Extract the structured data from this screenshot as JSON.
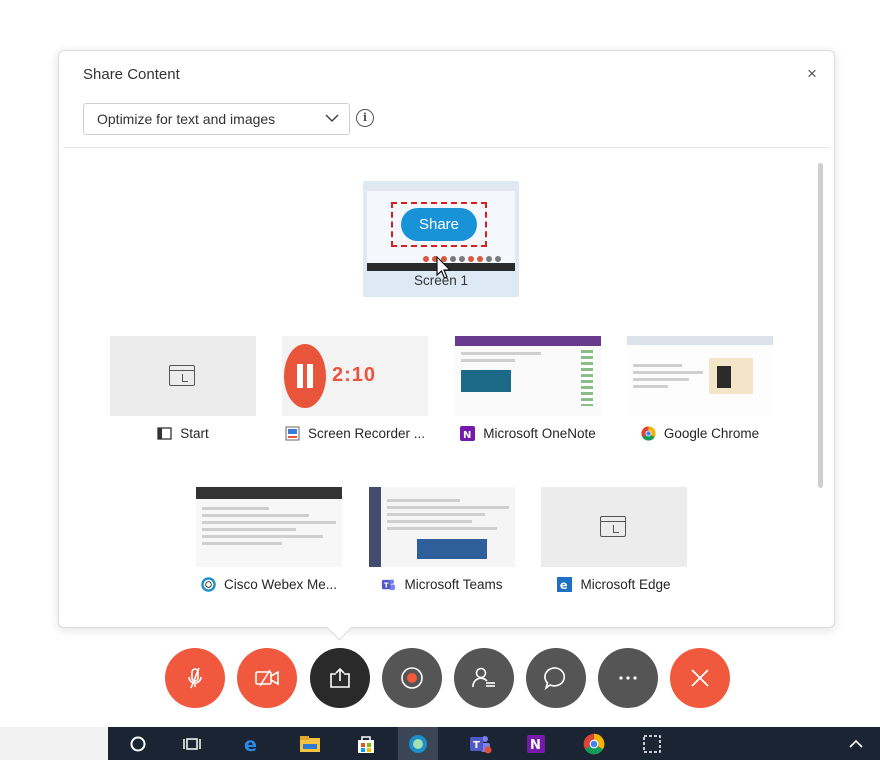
{
  "dialog": {
    "title": "Share Content",
    "close_glyph": "×",
    "optimize_select": {
      "value": "Optimize for text and images"
    },
    "info_glyph": "i"
  },
  "screen": {
    "label": "Screen 1",
    "share_button_label": "Share"
  },
  "recorder_thumb_text": "2:10",
  "apps": [
    {
      "label": "Start",
      "icon": "window-icon"
    },
    {
      "label": "Screen Recorder ...",
      "icon": "screen-recorder-icon"
    },
    {
      "label": "Microsoft OneNote",
      "icon": "onenote-icon"
    },
    {
      "label": "Google Chrome",
      "icon": "chrome-icon"
    },
    {
      "label": "Cisco Webex Me...",
      "icon": "webex-icon"
    },
    {
      "label": "Microsoft Teams",
      "icon": "teams-icon"
    },
    {
      "label": "Microsoft Edge",
      "icon": "edge-icon"
    }
  ],
  "controls": [
    {
      "name": "mute",
      "icon": "mic-off-icon",
      "color": "#f0593e"
    },
    {
      "name": "video",
      "icon": "camera-off-icon",
      "color": "#f0593e"
    },
    {
      "name": "share",
      "icon": "share-icon",
      "color": "#2a2a2a"
    },
    {
      "name": "record",
      "icon": "record-icon",
      "color": "#555555"
    },
    {
      "name": "participants",
      "icon": "participants-icon",
      "color": "#555555"
    },
    {
      "name": "chat",
      "icon": "chat-icon",
      "color": "#555555"
    },
    {
      "name": "more",
      "icon": "more-icon",
      "color": "#555555"
    },
    {
      "name": "leave",
      "icon": "close-icon",
      "color": "#f0593e"
    }
  ],
  "colors": {
    "accent_blue": "#1993d8",
    "danger_orange": "#f0593e",
    "highlight_red": "#d62020"
  },
  "taskbar": {
    "icons": [
      "cortana-icon",
      "task-view-icon",
      "edge-icon",
      "file-explorer-icon",
      "store-icon",
      "webex-icon",
      "teams-icon",
      "onenote-icon",
      "chrome-icon",
      "snip-icon",
      "chevron-up-icon"
    ]
  }
}
